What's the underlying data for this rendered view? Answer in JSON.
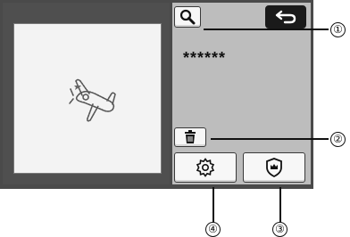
{
  "screen": {
    "masked_value": "******",
    "buttons": {
      "search_icon": "magnifier",
      "back_icon": "return-arrow",
      "delete_icon": "trash-can",
      "settings_icon": "gear",
      "premium_icon": "shield-crown"
    }
  },
  "callouts": [
    "①",
    "②",
    "③",
    "④"
  ],
  "colors": {
    "screen": "#4a4a4a",
    "panel": "#bdbdbd",
    "canvas": "#f3f3f3",
    "back_button": "#1a1a1a"
  }
}
